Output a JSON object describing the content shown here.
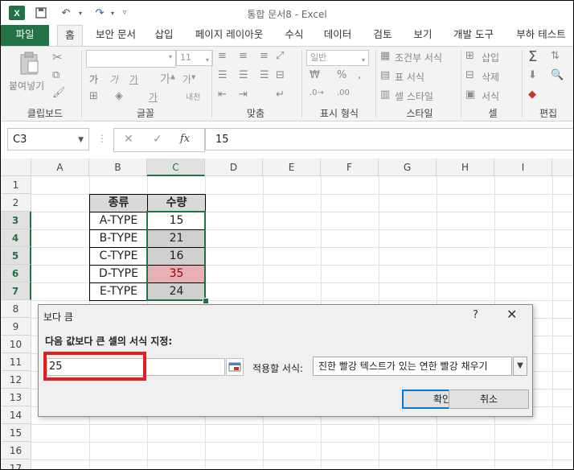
{
  "window": {
    "title": "통합 문서8 - Excel"
  },
  "tabs": [
    "파일",
    "홈",
    "보안 문서",
    "삽입",
    "페이지 레이아웃",
    "수식",
    "데이터",
    "검토",
    "보기",
    "개발 도구",
    "부하 테스트"
  ],
  "ribbon": {
    "groups": [
      "클립보드",
      "글꼴",
      "맞춤",
      "표시 형식",
      "스타일",
      "셀",
      "편집"
    ],
    "paste_label": "붙여넣기",
    "font_size": "11",
    "number_format": "일반",
    "style_items": [
      "조건부 서식",
      "표 서식",
      "셀 스타일"
    ],
    "cell_items": [
      "삽입",
      "삭제",
      "서식"
    ],
    "font_buttons": [
      "가",
      "가",
      "가",
      "가",
      "가"
    ],
    "wrap_label": "내천"
  },
  "formula_bar": {
    "name_box": "C3",
    "formula": "15",
    "fx": "fx"
  },
  "columns": [
    "A",
    "B",
    "C",
    "D",
    "E",
    "F",
    "G",
    "H",
    "I"
  ],
  "rows": [
    "1",
    "2",
    "3",
    "4",
    "5",
    "6",
    "7",
    "8",
    "9",
    "10",
    "11",
    "12",
    "13",
    "14",
    "15",
    "16",
    "17"
  ],
  "table": {
    "headers": [
      "종류",
      "수량"
    ],
    "rows": [
      {
        "type": "A-TYPE",
        "qty": "15"
      },
      {
        "type": "B-TYPE",
        "qty": "21"
      },
      {
        "type": "C-TYPE",
        "qty": "16"
      },
      {
        "type": "D-TYPE",
        "qty": "35"
      },
      {
        "type": "E-TYPE",
        "qty": "24"
      }
    ]
  },
  "dialog": {
    "title": "보다 큼",
    "help": "?",
    "close": "✕",
    "prompt": "다음 값보다 큰 셀의 서식 지정:",
    "value": "25",
    "format_label": "적용할 서식:",
    "format_value": "진한 빨강 텍스트가 있는 연한 빨강 채우기",
    "ok": "확인",
    "cancel": "취소"
  },
  "colors": {
    "excel_green": "#217346",
    "highlight_red_fill": "#e6b0b5",
    "highlight_red_text": "#9c0006",
    "annotation_red": "#e02020"
  }
}
